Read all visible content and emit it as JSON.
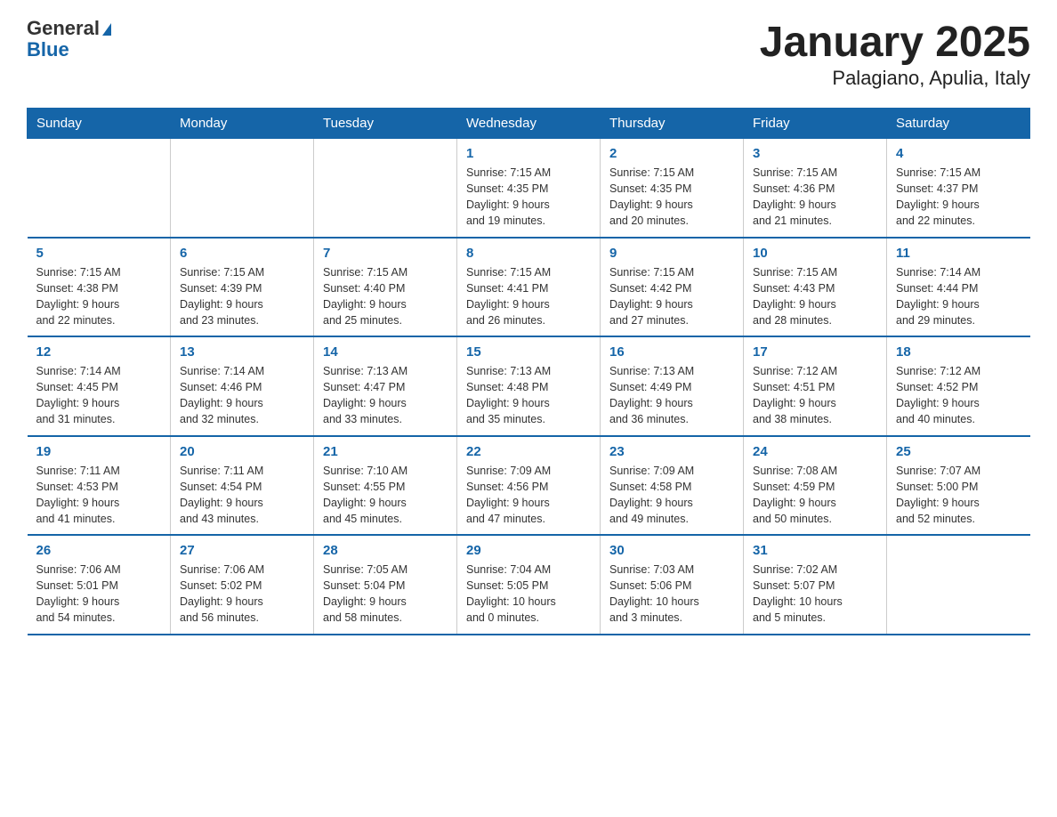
{
  "header": {
    "logo_general": "General",
    "logo_blue": "Blue",
    "title": "January 2025",
    "subtitle": "Palagiano, Apulia, Italy"
  },
  "days_of_week": [
    "Sunday",
    "Monday",
    "Tuesday",
    "Wednesday",
    "Thursday",
    "Friday",
    "Saturday"
  ],
  "weeks": [
    [
      {
        "day": "",
        "info": ""
      },
      {
        "day": "",
        "info": ""
      },
      {
        "day": "",
        "info": ""
      },
      {
        "day": "1",
        "info": "Sunrise: 7:15 AM\nSunset: 4:35 PM\nDaylight: 9 hours\nand 19 minutes."
      },
      {
        "day": "2",
        "info": "Sunrise: 7:15 AM\nSunset: 4:35 PM\nDaylight: 9 hours\nand 20 minutes."
      },
      {
        "day": "3",
        "info": "Sunrise: 7:15 AM\nSunset: 4:36 PM\nDaylight: 9 hours\nand 21 minutes."
      },
      {
        "day": "4",
        "info": "Sunrise: 7:15 AM\nSunset: 4:37 PM\nDaylight: 9 hours\nand 22 minutes."
      }
    ],
    [
      {
        "day": "5",
        "info": "Sunrise: 7:15 AM\nSunset: 4:38 PM\nDaylight: 9 hours\nand 22 minutes."
      },
      {
        "day": "6",
        "info": "Sunrise: 7:15 AM\nSunset: 4:39 PM\nDaylight: 9 hours\nand 23 minutes."
      },
      {
        "day": "7",
        "info": "Sunrise: 7:15 AM\nSunset: 4:40 PM\nDaylight: 9 hours\nand 25 minutes."
      },
      {
        "day": "8",
        "info": "Sunrise: 7:15 AM\nSunset: 4:41 PM\nDaylight: 9 hours\nand 26 minutes."
      },
      {
        "day": "9",
        "info": "Sunrise: 7:15 AM\nSunset: 4:42 PM\nDaylight: 9 hours\nand 27 minutes."
      },
      {
        "day": "10",
        "info": "Sunrise: 7:15 AM\nSunset: 4:43 PM\nDaylight: 9 hours\nand 28 minutes."
      },
      {
        "day": "11",
        "info": "Sunrise: 7:14 AM\nSunset: 4:44 PM\nDaylight: 9 hours\nand 29 minutes."
      }
    ],
    [
      {
        "day": "12",
        "info": "Sunrise: 7:14 AM\nSunset: 4:45 PM\nDaylight: 9 hours\nand 31 minutes."
      },
      {
        "day": "13",
        "info": "Sunrise: 7:14 AM\nSunset: 4:46 PM\nDaylight: 9 hours\nand 32 minutes."
      },
      {
        "day": "14",
        "info": "Sunrise: 7:13 AM\nSunset: 4:47 PM\nDaylight: 9 hours\nand 33 minutes."
      },
      {
        "day": "15",
        "info": "Sunrise: 7:13 AM\nSunset: 4:48 PM\nDaylight: 9 hours\nand 35 minutes."
      },
      {
        "day": "16",
        "info": "Sunrise: 7:13 AM\nSunset: 4:49 PM\nDaylight: 9 hours\nand 36 minutes."
      },
      {
        "day": "17",
        "info": "Sunrise: 7:12 AM\nSunset: 4:51 PM\nDaylight: 9 hours\nand 38 minutes."
      },
      {
        "day": "18",
        "info": "Sunrise: 7:12 AM\nSunset: 4:52 PM\nDaylight: 9 hours\nand 40 minutes."
      }
    ],
    [
      {
        "day": "19",
        "info": "Sunrise: 7:11 AM\nSunset: 4:53 PM\nDaylight: 9 hours\nand 41 minutes."
      },
      {
        "day": "20",
        "info": "Sunrise: 7:11 AM\nSunset: 4:54 PM\nDaylight: 9 hours\nand 43 minutes."
      },
      {
        "day": "21",
        "info": "Sunrise: 7:10 AM\nSunset: 4:55 PM\nDaylight: 9 hours\nand 45 minutes."
      },
      {
        "day": "22",
        "info": "Sunrise: 7:09 AM\nSunset: 4:56 PM\nDaylight: 9 hours\nand 47 minutes."
      },
      {
        "day": "23",
        "info": "Sunrise: 7:09 AM\nSunset: 4:58 PM\nDaylight: 9 hours\nand 49 minutes."
      },
      {
        "day": "24",
        "info": "Sunrise: 7:08 AM\nSunset: 4:59 PM\nDaylight: 9 hours\nand 50 minutes."
      },
      {
        "day": "25",
        "info": "Sunrise: 7:07 AM\nSunset: 5:00 PM\nDaylight: 9 hours\nand 52 minutes."
      }
    ],
    [
      {
        "day": "26",
        "info": "Sunrise: 7:06 AM\nSunset: 5:01 PM\nDaylight: 9 hours\nand 54 minutes."
      },
      {
        "day": "27",
        "info": "Sunrise: 7:06 AM\nSunset: 5:02 PM\nDaylight: 9 hours\nand 56 minutes."
      },
      {
        "day": "28",
        "info": "Sunrise: 7:05 AM\nSunset: 5:04 PM\nDaylight: 9 hours\nand 58 minutes."
      },
      {
        "day": "29",
        "info": "Sunrise: 7:04 AM\nSunset: 5:05 PM\nDaylight: 10 hours\nand 0 minutes."
      },
      {
        "day": "30",
        "info": "Sunrise: 7:03 AM\nSunset: 5:06 PM\nDaylight: 10 hours\nand 3 minutes."
      },
      {
        "day": "31",
        "info": "Sunrise: 7:02 AM\nSunset: 5:07 PM\nDaylight: 10 hours\nand 5 minutes."
      },
      {
        "day": "",
        "info": ""
      }
    ]
  ]
}
